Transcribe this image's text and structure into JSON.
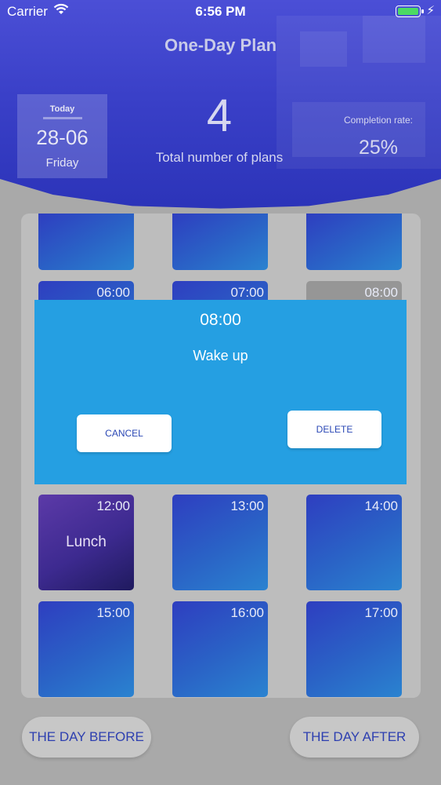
{
  "status_bar": {
    "carrier": "Carrier",
    "time": "6:56 PM"
  },
  "header": {
    "title": "One-Day Plan",
    "today": {
      "label": "Today",
      "date": "28-06",
      "weekday": "Friday"
    },
    "total": {
      "value": "4",
      "label": "Total number of plans"
    },
    "completion": {
      "label": "Completion rate:",
      "value": "25%"
    }
  },
  "grid": {
    "rows": [
      [
        {
          "time": "",
          "plan": ""
        },
        {
          "time": "",
          "plan": ""
        },
        {
          "time": "",
          "plan": ""
        }
      ],
      [
        {
          "time": "06:00",
          "plan": ""
        },
        {
          "time": "07:00",
          "plan": ""
        },
        {
          "time": "08:00",
          "plan": ""
        }
      ],
      [
        {
          "time": "12:00",
          "plan": "Lunch"
        },
        {
          "time": "13:00",
          "plan": ""
        },
        {
          "time": "14:00",
          "plan": ""
        }
      ],
      [
        {
          "time": "15:00",
          "plan": ""
        },
        {
          "time": "16:00",
          "plan": ""
        },
        {
          "time": "17:00",
          "plan": ""
        }
      ]
    ]
  },
  "modal": {
    "time": "08:00",
    "title": "Wake up",
    "cancel_label": "CANCEL",
    "delete_label": "DELETE"
  },
  "nav": {
    "before_label": "THE DAY BEFORE",
    "after_label": "THE DAY AFTER"
  },
  "colors": {
    "header_blue": "#3a40c8",
    "modal_blue": "#259fe2",
    "button_text": "#2a47b5",
    "battery_green": "#4cd964"
  }
}
